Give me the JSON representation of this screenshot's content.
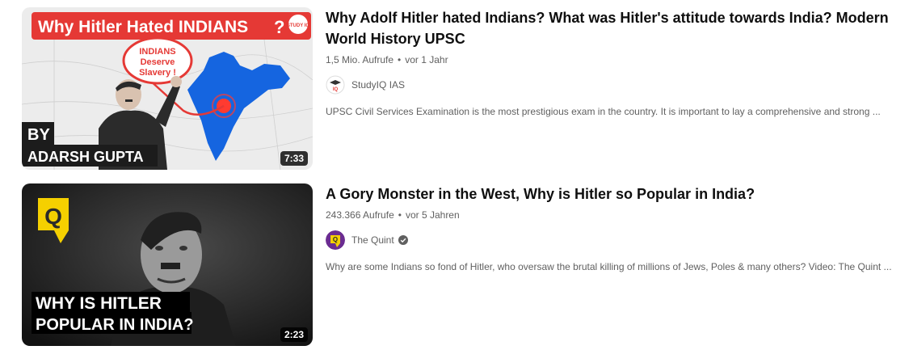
{
  "videos": [
    {
      "thumbnail": {
        "headline": "Why Hitler Hated INDIANS",
        "question_mark": "?",
        "logo_text": "STUDY IQ",
        "bubble_line1": "INDIANS",
        "bubble_line2": "Deserve",
        "bubble_line3": "Slavery !",
        "by_label": "BY",
        "author": "ADARSH GUPTA",
        "duration": "7:33"
      },
      "title": "Why Adolf Hitler hated Indians? What was Hitler's attitude towards India? Modern World History UPSC",
      "views": "1,5 Mio. Aufrufe",
      "age": "vor 1 Jahr",
      "channel": "StudyIQ IAS",
      "verified": false,
      "description": "UPSC Civil Services Examination is the most prestigious exam in the country. It is important to lay a comprehensive and strong ..."
    },
    {
      "thumbnail": {
        "overlay_line1": "WHY IS HITLER",
        "overlay_line2": "POPULAR IN INDIA?",
        "logo_letter": "Q",
        "duration": "2:23"
      },
      "title": "A Gory Monster in the West, Why is Hitler so Popular in India?",
      "views": "243.366 Aufrufe",
      "age": "vor 5 Jahren",
      "channel": "The Quint",
      "verified": true,
      "description": "Why are some Indians so fond of Hitler, who oversaw the brutal killing of millions of Jews, Poles & many others? Video: The Quint ..."
    }
  ],
  "colors": {
    "headline_bg": "#e53935",
    "quint_yellow": "#f5d000",
    "quint_purple": "#6b2c91",
    "text_primary": "#0f0f0f",
    "text_secondary": "#606060"
  },
  "icons": {
    "verified": "verified-check-icon",
    "separator": "•"
  }
}
